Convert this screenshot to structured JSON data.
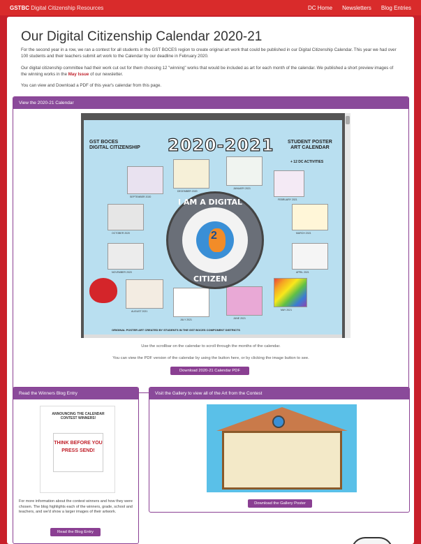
{
  "topbar": {
    "brand_bold": "GSTBC",
    "brand_rest": "Digital Citizenship Resources",
    "nav": [
      "DC Home",
      "Newsletters",
      "Blog Entries"
    ]
  },
  "main": {
    "title": "Our Digital Citizenship Calendar 2020-21",
    "p1": "For the second year in a row, we ran a contest for all students in the GST BOCES region to create original art work that could be published in our Digital Citizenship Calendar. This year we had over 100 students and their teachers submit art work to the Calendar by our deadline in February 2020.",
    "p2_a": "Our digital citizenship committee had their work cut out for them choosing 12 \"winning\" works that would be included as art for each month of the calendar. We published a short preview images of the winning works in the ",
    "p2_link": "May Issue",
    "p2_b": " of our newsletter.",
    "p3": "You can view and Download a PDF of this year's calendar from this page."
  },
  "calendar_panel": {
    "header": "View the 2020-21 Calendar",
    "calendar": {
      "left_title": "GST BOCES\nDIGITAL CITIZENSHIP",
      "year": "2020-2021",
      "right_title": "STUDENT POSTER\nART CALENDAR",
      "plus": "+ 12 DC ACTIVITIES",
      "emblem_top": "I AM A DIGITAL",
      "emblem_bottom": "CITIZEN",
      "emblem_number": "2",
      "bottom_text": "ORIGINAL POSTER ART CREATED BY STUDENTS IN THE GST BOCES COMPONENT DISTRICTS",
      "months": [
        "SEPTEMBER 2020",
        "DECEMBER 2020",
        "JANUARY 2021",
        "FEBRUARY 2021",
        "OCTOBER 2020",
        "MARCH 2021",
        "NOVEMBER 2020",
        "APRIL 2021",
        "AUGUST 2021",
        "JULY 2021",
        "JUNE 2021",
        "MAY 2021"
      ]
    },
    "caption1": "Use the scrollbar on the calendar to scroll through the months of the calendar.",
    "caption2": "You can view the PDF version of the calendar by using the button here, or by clicking the image button to see.",
    "button": "Download 2020-21 Calendar PDF"
  },
  "blog_panel": {
    "header": "Read the Winners Blog Entry",
    "image_title": "ANNOUNCING THE CALENDAR CONTEST WINNERS!",
    "image_poster": "THINK BEFORE YOU PRESS SEND!",
    "text": "For more information about the contest winners and how they were chosen. The blog highlights each of the winners, grade, school and teachers, and we'd show a larger images of their artwork.",
    "button": "Read the Blog Entry"
  },
  "gallery_panel": {
    "header": "Visit the Gallery to view all of the Art from the Contest",
    "button": "Download the Gallery Poster"
  }
}
